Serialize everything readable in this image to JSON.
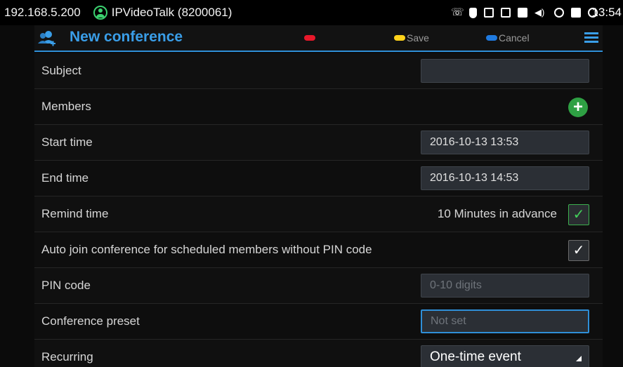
{
  "statusbar": {
    "ip": "192.168.5.200",
    "account": "IPVideoTalk (8200061)",
    "clock": "13:54",
    "icons": [
      "phone-icon",
      "mute-icon",
      "screen-icon",
      "calendar-icon",
      "lock-icon",
      "volume-icon",
      "cloud-icon",
      "storage-icon",
      "sync-icon"
    ]
  },
  "header": {
    "title": "New conference",
    "save_label": "Save",
    "cancel_label": "Cancel",
    "colors": {
      "accent": "#2f8fd8",
      "red": "#e8182a",
      "yellow": "#ffd21a",
      "blue": "#1f7ae0"
    }
  },
  "form": {
    "subject": {
      "label": "Subject",
      "value": ""
    },
    "members": {
      "label": "Members",
      "add_symbol": "+"
    },
    "start_time": {
      "label": "Start time",
      "value": "2016-10-13 13:53"
    },
    "end_time": {
      "label": "End time",
      "value": "2016-10-13 14:53"
    },
    "remind_time": {
      "label": "Remind time",
      "value": "10 Minutes in advance",
      "checked": true,
      "check_symbol": "✓"
    },
    "auto_join": {
      "label": "Auto join conference for scheduled members without PIN code",
      "checked": true,
      "check_symbol": "✓"
    },
    "pin_code": {
      "label": "PIN code",
      "placeholder": "0-10 digits"
    },
    "preset": {
      "label": "Conference preset",
      "placeholder": "Not set"
    },
    "recurring": {
      "label": "Recurring",
      "value": "One-time event"
    }
  }
}
